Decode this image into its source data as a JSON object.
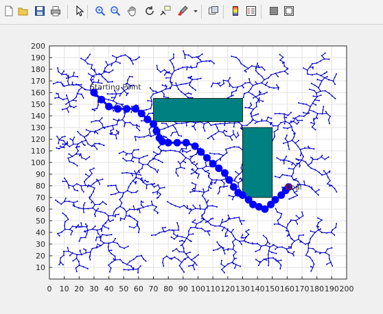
{
  "toolbar": {
    "items": [
      {
        "name": "new-figure-icon"
      },
      {
        "name": "open-file-icon"
      },
      {
        "name": "save-icon"
      },
      {
        "name": "print-icon"
      },
      {
        "name": "separator"
      },
      {
        "name": "pointer-icon"
      },
      {
        "name": "separator"
      },
      {
        "name": "zoom-in-icon"
      },
      {
        "name": "zoom-out-icon"
      },
      {
        "name": "pan-hand-icon"
      },
      {
        "name": "rotate-3d-icon"
      },
      {
        "name": "data-cursor-icon"
      },
      {
        "name": "brush-icon"
      },
      {
        "name": "brush-dropdown-icon"
      },
      {
        "name": "separator"
      },
      {
        "name": "link-plot-icon"
      },
      {
        "name": "separator"
      },
      {
        "name": "colorbar-icon"
      },
      {
        "name": "legend-icon"
      },
      {
        "name": "separator"
      },
      {
        "name": "hide-plot-tools-icon"
      },
      {
        "name": "show-plot-tools-icon"
      }
    ]
  },
  "chart_data": {
    "type": "scatter",
    "title": "",
    "xlabel": "",
    "ylabel": "",
    "xlim": [
      0,
      200
    ],
    "ylim": [
      0,
      200
    ],
    "x_ticks": [
      0,
      10,
      20,
      30,
      40,
      50,
      60,
      70,
      80,
      90,
      100,
      110,
      120,
      130,
      140,
      150,
      160,
      170,
      180,
      190,
      200
    ],
    "y_ticks": [
      10,
      20,
      30,
      40,
      50,
      60,
      70,
      80,
      90,
      100,
      110,
      120,
      130,
      140,
      150,
      160,
      170,
      180,
      190,
      200
    ],
    "grid": true,
    "colors": {
      "tree": "#0000cc",
      "path": "#0000ff",
      "obstacle": "#008080",
      "goal": "#e00000"
    },
    "annotations": [
      {
        "text": "Starting Point",
        "x": 30,
        "y": 165
      },
      {
        "text": "Goal",
        "x": 161,
        "y": 79
      }
    ],
    "obstacles": [
      {
        "x1": 70,
        "y1": 135,
        "x2": 130,
        "y2": 155
      },
      {
        "x1": 130,
        "y1": 70,
        "x2": 150,
        "y2": 130
      }
    ],
    "start": {
      "x": 30,
      "y": 160
    },
    "goal": {
      "x": 161,
      "y": 79
    },
    "path": [
      [
        30,
        160
      ],
      [
        35,
        154
      ],
      [
        40,
        148
      ],
      [
        46,
        146
      ],
      [
        52,
        146
      ],
      [
        58,
        146
      ],
      [
        62,
        142
      ],
      [
        66,
        137
      ],
      [
        70,
        133
      ],
      [
        72,
        127
      ],
      [
        74,
        121
      ],
      [
        76,
        118
      ],
      [
        80,
        117
      ],
      [
        86,
        117
      ],
      [
        92,
        117
      ],
      [
        98,
        114
      ],
      [
        102,
        109
      ],
      [
        106,
        104
      ],
      [
        110,
        99
      ],
      [
        114,
        95
      ],
      [
        118,
        91
      ],
      [
        121,
        85
      ],
      [
        124,
        79
      ],
      [
        127,
        74
      ],
      [
        130,
        72
      ],
      [
        134,
        68
      ],
      [
        137,
        64
      ],
      [
        141,
        62
      ],
      [
        145,
        60
      ],
      [
        149,
        64
      ],
      [
        152,
        68
      ],
      [
        156,
        72
      ],
      [
        159,
        76
      ],
      [
        161,
        79
      ]
    ],
    "tree_seed": 7
  }
}
